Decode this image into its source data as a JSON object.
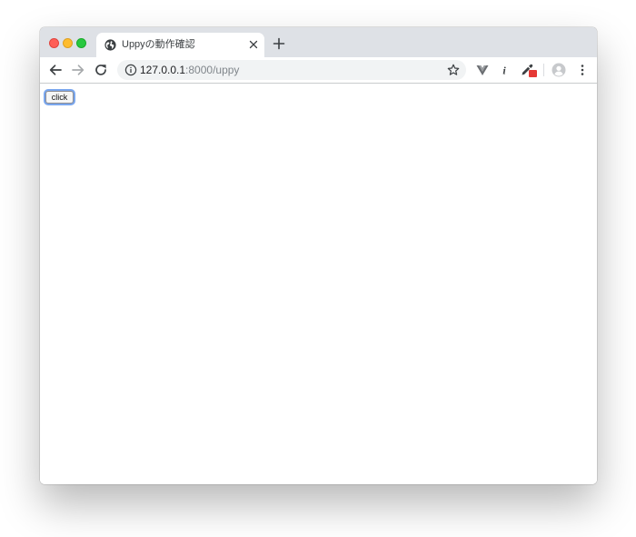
{
  "window": {
    "controls": [
      "close",
      "minimize",
      "maximize"
    ]
  },
  "tab": {
    "title": "Uppyの動作確認",
    "favicon": "globe-icon"
  },
  "toolbar": {
    "back_icon": "back-arrow-icon",
    "forward_icon": "forward-arrow-icon",
    "reload_icon": "reload-icon",
    "address": {
      "info_icon": "info-icon",
      "url_host": "127.0.0.1",
      "url_rest": ":8000/uppy",
      "star_icon": "star-icon"
    },
    "extensions": [
      "vue-devtools-icon",
      "info-extension-icon",
      "eyedropper-extension-icon"
    ],
    "profile_icon": "profile-avatar-icon",
    "menu_icon": "more-vertical-icon"
  },
  "page": {
    "button_label": "click"
  },
  "colors": {
    "tabstrip": "#dee1e6",
    "omnibox": "#f1f3f4",
    "focus_ring": "#7aa7ee",
    "badge": "#e53935"
  }
}
